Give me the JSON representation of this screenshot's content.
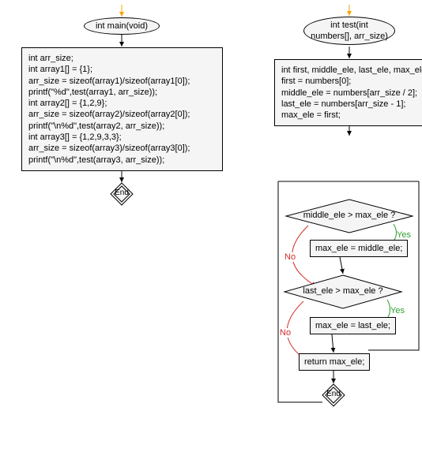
{
  "flowcharts": {
    "main": {
      "start": "int main(void)",
      "code": "int arr_size;\nint array1[] = {1};\narr_size = sizeof(array1)/sizeof(array1[0]);\nprintf(\"%d\",test(array1, arr_size));\nint array2[] = {1,2,9};\narr_size = sizeof(array2)/sizeof(array2[0]);\nprintf(\"\\n%d\",test(array2, arr_size));\nint array3[] = {1,2,9,3,3};\narr_size = sizeof(array3)/sizeof(array3[0]);\nprintf(\"\\n%d\",test(array3, arr_size));",
      "end": "End"
    },
    "test": {
      "start": "int test(int\nnumbers[], arr_size)",
      "code": "int first, middle_ele, last_ele, max_ele;\nfirst = numbers[0];\nmiddle_ele = numbers[arr_size / 2];\nlast_ele = numbers[arr_size - 1];\nmax_ele = first;",
      "cond1": "middle_ele > max_ele ?",
      "assign1": "max_ele = middle_ele;",
      "cond2": "last_ele > max_ele ?",
      "assign2": "max_ele = last_ele;",
      "ret": "return max_ele;",
      "end": "End",
      "yes": "Yes",
      "no": "No"
    }
  }
}
